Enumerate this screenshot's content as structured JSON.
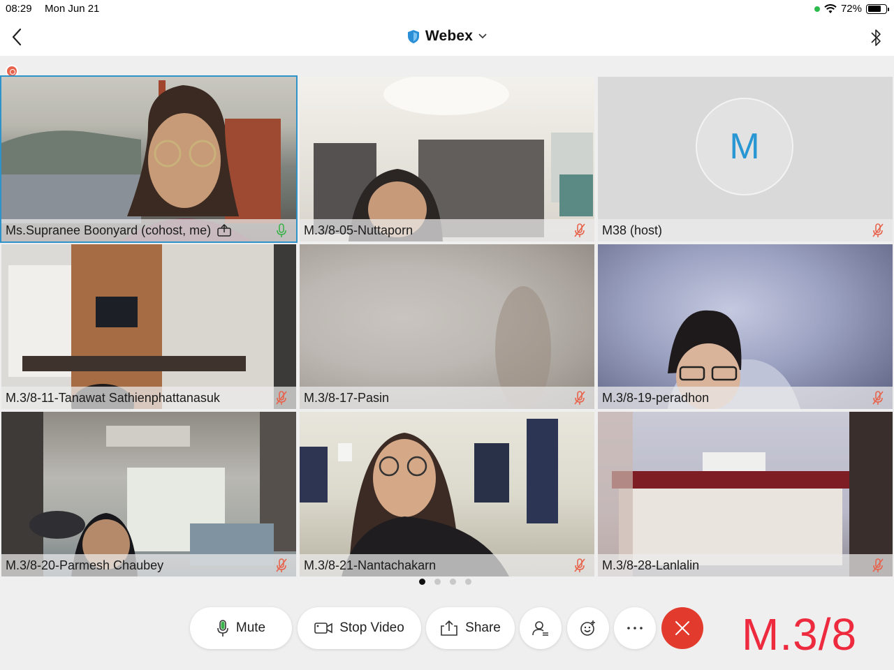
{
  "status_bar": {
    "time": "08:29",
    "date": "Mon Jun 21",
    "battery": "72%"
  },
  "nav": {
    "title": "Webex"
  },
  "participants": [
    {
      "name": "Ms.Supranee Boonyard (cohost, me)",
      "mic": "on",
      "sharing_icon": "share-icon"
    },
    {
      "name": "M.3/8-05-Nuttaporn",
      "mic": "muted"
    },
    {
      "name": "M38 (host)",
      "mic": "muted",
      "avatar_letter": "M"
    },
    {
      "name": "M.3/8-11-Tanawat Sathienphattanasuk",
      "mic": "muted"
    },
    {
      "name": "M.3/8-17-Pasin",
      "mic": "muted"
    },
    {
      "name": "M.3/8-19-peradhon",
      "mic": "muted"
    },
    {
      "name": "M.3/8-20-Parmesh Chaubey",
      "mic": "muted"
    },
    {
      "name": "M.3/8-21-Nantachakarn",
      "mic": "muted"
    },
    {
      "name": "M.3/8-28-Lanlalin",
      "mic": "muted"
    }
  ],
  "pagination": {
    "pages": 4,
    "current": 1
  },
  "controls": {
    "mute": "Mute",
    "stop_video": "Stop Video",
    "share": "Share"
  },
  "overlay_label": "M.3/8",
  "colors": {
    "accent": "#2e93c9",
    "end_call": "#e23b2e",
    "muted_mic": "#e8634c",
    "active_mic": "#3cb24a",
    "overlay_text": "#ee2a3e"
  }
}
